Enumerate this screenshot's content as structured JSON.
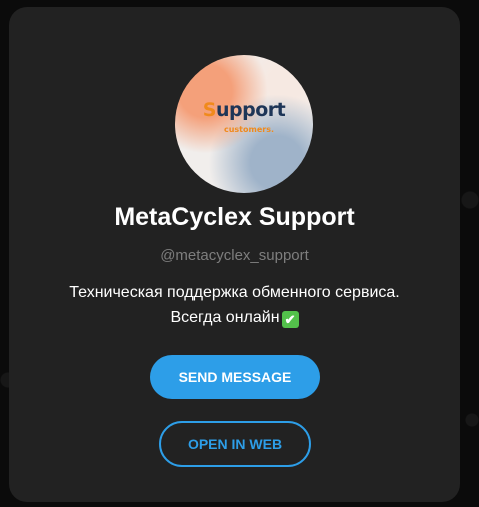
{
  "profile": {
    "avatar_logo": {
      "main_initial": "S",
      "main_rest": "upport",
      "sub": "customers."
    },
    "name": "MetaCyclex Support",
    "username": "@metacyclex_support",
    "description_line1": "Техническая поддержка обменного сервиса.",
    "description_line2": "Всегда онлайн",
    "status_emoji": "✔"
  },
  "actions": {
    "send_message": "SEND MESSAGE",
    "open_in_web": "OPEN IN WEB"
  },
  "colors": {
    "card_background": "#222222",
    "accent": "#2d9ee8",
    "logo_orange": "#f08a1c",
    "logo_navy": "#1d3557",
    "check_green": "#53c14b"
  }
}
